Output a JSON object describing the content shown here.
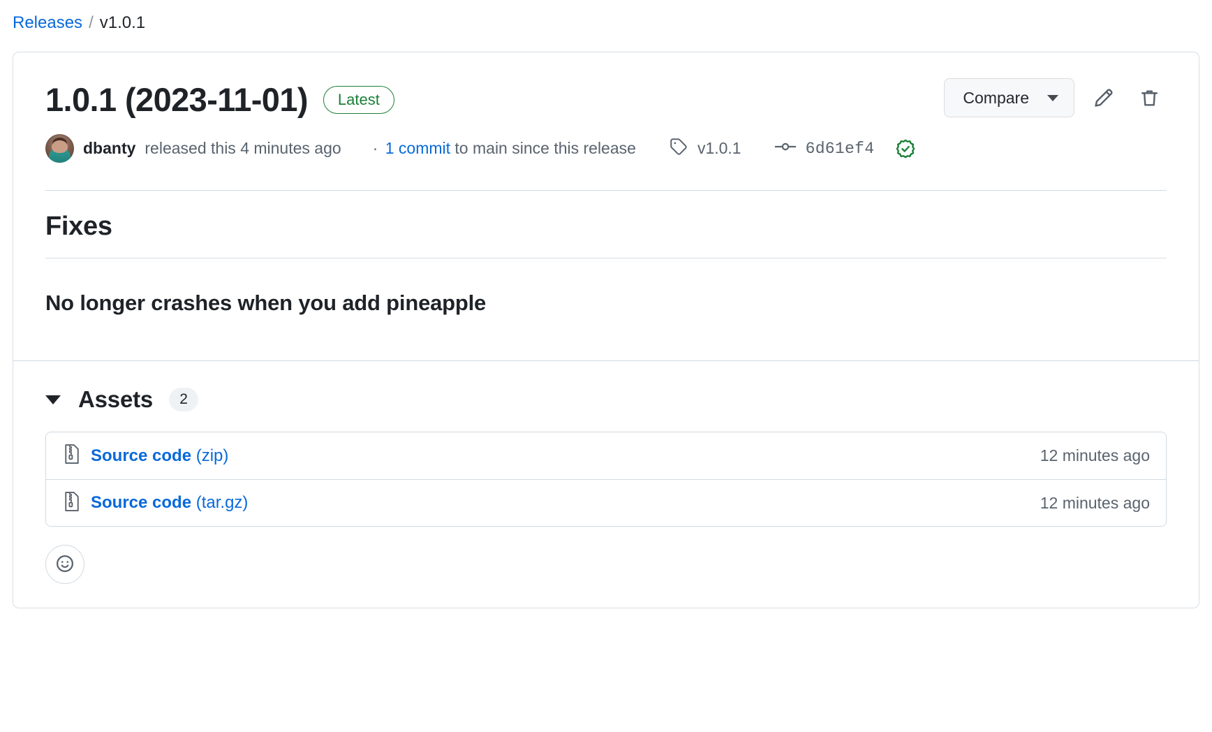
{
  "breadcrumb": {
    "parent_label": "Releases",
    "separator": "/",
    "current_label": "v1.0.1"
  },
  "release": {
    "title": "1.0.1 (2023-11-01)",
    "latest_badge": "Latest",
    "author": "dbanty",
    "released_text": "released this 4 minutes ago",
    "commit_dot": "·",
    "commit_link": "1 commit",
    "commit_suffix": "to main since this release",
    "tag_name": "v1.0.1",
    "commit_sha": "6d61ef4",
    "verified_icon": "verified-check-icon",
    "tag_icon": "tag-icon",
    "commit_icon": "git-commit-icon",
    "avatar_icon": "user-avatar"
  },
  "actions": {
    "compare_label": "Compare",
    "compare_caret_icon": "chevron-down-icon",
    "edit_icon": "pencil-icon",
    "delete_icon": "trash-icon"
  },
  "notes": {
    "heading": "Fixes",
    "subheading": "No longer crashes when you add pineapple"
  },
  "assets": {
    "title": "Assets",
    "count": "2",
    "disclosure_icon": "triangle-down-icon",
    "rows": [
      {
        "icon": "file-zip-icon",
        "name": "Source code",
        "format": "(zip)",
        "time": "12 minutes ago"
      },
      {
        "icon": "file-zip-icon",
        "name": "Source code",
        "format": "(tar.gz)",
        "time": "12 minutes ago"
      }
    ]
  },
  "reactions": {
    "add_reaction_icon": "smiley-icon"
  },
  "colors": {
    "link": "#0969da",
    "success": "#1a7f37",
    "text": "#1f2328",
    "muted": "#59636e",
    "border": "#d1d9e0"
  }
}
